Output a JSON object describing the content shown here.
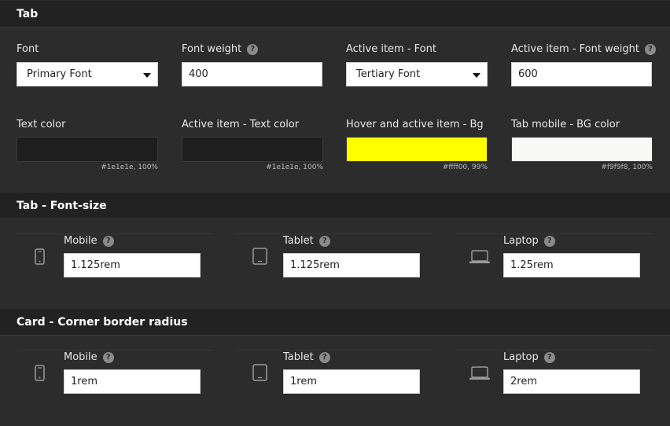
{
  "tab_section": {
    "title": "Tab",
    "font": {
      "label": "Font",
      "value": "Primary Font"
    },
    "font_weight": {
      "label": "Font weight",
      "value": "400"
    },
    "active_font": {
      "label": "Active item - Font",
      "value": "Tertiary Font"
    },
    "active_font_weight": {
      "label": "Active item - Font weight",
      "value": "600"
    },
    "text_color": {
      "label": "Text color",
      "color": "#1e1e1e",
      "caption": "#1e1e1e, 100%"
    },
    "active_text_color": {
      "label": "Active item - Text color",
      "color": "#1e1e1e",
      "caption": "#1e1e1e, 100%"
    },
    "hover_bg": {
      "label": "Hover and active item - Bg",
      "color": "#ffff00",
      "caption": "#ffff00, 99%"
    },
    "mobile_bg": {
      "label": "Tab mobile - BG color",
      "color": "#f9f9f8",
      "caption": "#f9f9f8, 100%"
    }
  },
  "font_size_section": {
    "title": "Tab - Font-size",
    "mobile": {
      "label": "Mobile",
      "value": "1.125rem",
      "icon": "mobile-icon"
    },
    "tablet": {
      "label": "Tablet",
      "value": "1.125rem",
      "icon": "tablet-icon"
    },
    "laptop": {
      "label": "Laptop",
      "value": "1.25rem",
      "icon": "laptop-icon"
    }
  },
  "radius_section": {
    "title": "Card - Corner border radius",
    "mobile": {
      "label": "Mobile",
      "value": "1rem",
      "icon": "mobile-icon"
    },
    "tablet": {
      "label": "Tablet",
      "value": "1rem",
      "icon": "tablet-icon"
    },
    "laptop": {
      "label": "Laptop",
      "value": "2rem",
      "icon": "laptop-icon"
    }
  },
  "help_glyph": "?"
}
